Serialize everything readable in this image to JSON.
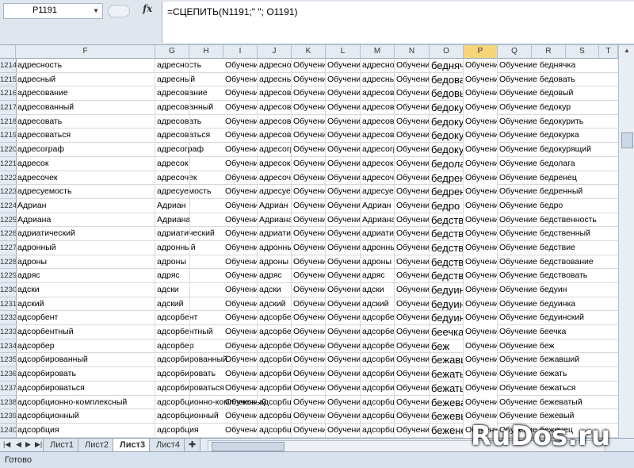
{
  "formula_bar": {
    "name_box": "P1191",
    "fx_label": "fx",
    "formula": "=СЦЕПИТЬ(N1191;\" \"; O1191)"
  },
  "columns": [
    "F",
    "G",
    "H",
    "I",
    "J",
    "K",
    "L",
    "M",
    "N",
    "O",
    "P",
    "Q",
    "R",
    "S",
    "T"
  ],
  "selected_column": "P",
  "rows": [
    {
      "num": "1214",
      "f": "адресность",
      "g": "адресность",
      "i": "Обучение",
      "j": "адресность",
      "k": "Обучение",
      "l": "Обучение",
      "m": "адресность",
      "n": "Обучение",
      "o": "беднячка",
      "p": "Обучение",
      "q": "Обучение беднячка"
    },
    {
      "num": "1215",
      "f": "адресный",
      "g": "адресный",
      "i": "Обучение",
      "j": "адресный",
      "k": "Обучение",
      "l": "Обучение",
      "m": "адресный",
      "n": "Обучение",
      "o": "бедовать",
      "p": "Обучение",
      "q": "Обучение бедовать"
    },
    {
      "num": "1216",
      "f": "адресование",
      "g": "адресование",
      "i": "Обучение",
      "j": "адресование",
      "k": "Обучение",
      "l": "Обучение",
      "m": "адресование",
      "n": "Обучение",
      "o": "бедовый",
      "p": "Обучение",
      "q": "Обучение бедовый"
    },
    {
      "num": "1217",
      "f": "адресованный",
      "g": "адресованный",
      "i": "Обучение",
      "j": "адресованный",
      "k": "Обучение",
      "l": "Обучение",
      "m": "адресованный",
      "n": "Обучение",
      "o": "бедокур",
      "p": "Обучение",
      "q": "Обучение бедокур"
    },
    {
      "num": "1218",
      "f": "адресовать",
      "g": "адресовать",
      "i": "Обучение",
      "j": "адресовать",
      "k": "Обучение",
      "l": "Обучение",
      "m": "адресовать",
      "n": "Обучение",
      "o": "бедокурить",
      "p": "Обучение",
      "q": "Обучение бедокурить"
    },
    {
      "num": "1219",
      "f": "адресоваться",
      "g": "адресоваться",
      "i": "Обучение",
      "j": "адресоваться",
      "k": "Обучение",
      "l": "Обучение",
      "m": "адресоваться",
      "n": "Обучение",
      "o": "бедокурка",
      "p": "Обучение",
      "q": "Обучение бедокурка"
    },
    {
      "num": "1220",
      "f": "адресограф",
      "g": "адресограф",
      "i": "Обучение",
      "j": "адресограф",
      "k": "Обучение",
      "l": "Обучение",
      "m": "адресограф",
      "n": "Обучение",
      "o": "бедокурящий",
      "p": "Обучение",
      "q": "Обучение бедокурящий"
    },
    {
      "num": "1221",
      "f": "адресок",
      "g": "адресок",
      "i": "Обучение",
      "j": "адресок",
      "k": "Обучение",
      "l": "Обучение",
      "m": "адресок",
      "n": "Обучение",
      "o": "бедолага",
      "p": "Обучение",
      "q": "Обучение бедолага"
    },
    {
      "num": "1222",
      "f": "адресочек",
      "g": "адресочек",
      "i": "Обучение",
      "j": "адресочек",
      "k": "Обучение",
      "l": "Обучение",
      "m": "адресочек",
      "n": "Обучение",
      "o": "бедренец",
      "p": "Обучение",
      "q": "Обучение бедренец"
    },
    {
      "num": "1223",
      "f": "адресуемость",
      "g": "адресуемость",
      "i": "Обучение",
      "j": "адресуемость",
      "k": "Обучение",
      "l": "Обучение",
      "m": "адресуемость",
      "n": "Обучение",
      "o": "бедренный",
      "p": "Обучение",
      "q": "Обучение бедренный"
    },
    {
      "num": "1224",
      "f": "Адриан",
      "g": "Адриан",
      "i": "Обучение",
      "j": "Адриан",
      "k": "Обучение",
      "l": "Обучение",
      "m": "Адриан",
      "n": "Обучение",
      "o": "бедро",
      "p": "Обучение",
      "q": "Обучение бедро"
    },
    {
      "num": "1225",
      "f": "Адриана",
      "g": "Адриана",
      "i": "Обучение",
      "j": "Адриана",
      "k": "Обучение",
      "l": "Обучение",
      "m": "Адриана",
      "n": "Обучение",
      "o": "бедственность",
      "p": "Обучение",
      "q": "Обучение бедственность"
    },
    {
      "num": "1226",
      "f": "адриатический",
      "g": "адриатический",
      "i": "Обучение",
      "j": "адриатический",
      "k": "Обучение",
      "l": "Обучение",
      "m": "адриатический",
      "n": "Обучение",
      "o": "бедственный",
      "p": "Обучение",
      "q": "Обучение бедственный"
    },
    {
      "num": "1227",
      "f": "адронный",
      "g": "адронный",
      "i": "Обучение",
      "j": "адронный",
      "k": "Обучение",
      "l": "Обучение",
      "m": "адронный",
      "n": "Обучение",
      "o": "бедствие",
      "p": "Обучение",
      "q": "Обучение бедствие"
    },
    {
      "num": "1228",
      "f": "адроны",
      "g": "адроны",
      "i": "Обучение",
      "j": "адроны",
      "k": "Обучение",
      "l": "Обучение",
      "m": "адроны",
      "n": "Обучение",
      "o": "бедствование",
      "p": "Обучение",
      "q": "Обучение бедствование"
    },
    {
      "num": "1229",
      "f": "адряс",
      "g": "адряс",
      "i": "Обучение",
      "j": "адряс",
      "k": "Обучение",
      "l": "Обучение",
      "m": "адряс",
      "n": "Обучение",
      "o": "бедствовать",
      "p": "Обучение",
      "q": "Обучение бедствовать"
    },
    {
      "num": "1230",
      "f": "адски",
      "g": "адски",
      "i": "Обучение",
      "j": "адски",
      "k": "Обучение",
      "l": "Обучение",
      "m": "адски",
      "n": "Обучение",
      "o": "бедуин",
      "p": "Обучение",
      "q": "Обучение бедуин"
    },
    {
      "num": "1231",
      "f": "адский",
      "g": "адский",
      "i": "Обучение",
      "j": "адский",
      "k": "Обучение",
      "l": "Обучение",
      "m": "адский",
      "n": "Обучение",
      "o": "бедуинка",
      "p": "Обучение",
      "q": "Обучение бедуинка"
    },
    {
      "num": "1232",
      "f": "адсорбент",
      "g": "адсорбент",
      "i": "Обучение",
      "j": "адсорбент",
      "k": "Обучение",
      "l": "Обучение",
      "m": "адсорбент",
      "n": "Обучение",
      "o": "бедуинский",
      "p": "Обучение",
      "q": "Обучение бедуинский"
    },
    {
      "num": "1233",
      "f": "адсорбентный",
      "g": "адсорбентный",
      "i": "Обучение",
      "j": "адсорбентный",
      "k": "Обучение",
      "l": "Обучение",
      "m": "адсорбентный",
      "n": "Обучение",
      "o": "беечка",
      "p": "Обучение",
      "q": "Обучение беечка"
    },
    {
      "num": "1234",
      "f": "адсорбер",
      "g": "адсорбер",
      "i": "Обучение",
      "j": "адсорбер",
      "k": "Обучение",
      "l": "Обучение",
      "m": "адсорбер",
      "n": "Обучение",
      "o": "беж",
      "p": "Обучение",
      "q": "Обучение беж"
    },
    {
      "num": "1235",
      "f": "адсорбированный",
      "g": "адсорбированный",
      "i": "Обучение",
      "j": "адсорбированный",
      "k": "Обучение",
      "l": "Обучение",
      "m": "адсорбированный",
      "n": "Обучение",
      "o": "бежавший",
      "p": "Обучение",
      "q": "Обучение бежавший"
    },
    {
      "num": "1236",
      "f": "адсорбировать",
      "g": "адсорбировать",
      "i": "Обучение",
      "j": "адсорбировать",
      "k": "Обучение",
      "l": "Обучение",
      "m": "адсорбировать",
      "n": "Обучение",
      "o": "бежать",
      "p": "Обучение",
      "q": "Обучение бежать"
    },
    {
      "num": "1237",
      "f": "адсорбироваться",
      "g": "адсорбироваться",
      "i": "Обучение",
      "j": "адсорбироваться",
      "k": "Обучение",
      "l": "Обучение",
      "m": "адсорбироваться",
      "n": "Обучение",
      "o": "бежаться",
      "p": "Обучение",
      "q": "Обучение бежаться"
    },
    {
      "num": "1238",
      "f": "адсорбционно-комплексный",
      "g": "адсорбционно-комплексный",
      "i": "Обучение",
      "j": "адсорбционно-комплексный",
      "k": "Обучение",
      "l": "Обучение",
      "m": "адсорбционно-комплексный",
      "n": "Обучение",
      "o": "бежеватый",
      "p": "Обучение",
      "q": "Обучение бежеватый"
    },
    {
      "num": "1239",
      "f": "адсорбционный",
      "g": "адсорбционный",
      "i": "Обучение",
      "j": "адсорбционный",
      "k": "Обучение",
      "l": "Обучение",
      "m": "адсорбционный",
      "n": "Обучение",
      "o": "бежевый",
      "p": "Обучение",
      "q": "Обучение бежевый"
    },
    {
      "num": "1240",
      "f": "адсорбция",
      "g": "адсорбция",
      "i": "Обучение",
      "j": "адсорбция",
      "k": "Обучение",
      "l": "Обучение",
      "m": "адсорбция",
      "n": "Обучение",
      "o": "беженец",
      "p": "Обучение",
      "q": "Обучение беженец"
    }
  ],
  "sheet_tabs": [
    {
      "label": "Лист1",
      "active": false
    },
    {
      "label": "Лист2",
      "active": false
    },
    {
      "label": "Лист3",
      "active": true
    },
    {
      "label": "Лист4",
      "active": false
    }
  ],
  "status": "Готово",
  "watermark": "RuDos.ru"
}
